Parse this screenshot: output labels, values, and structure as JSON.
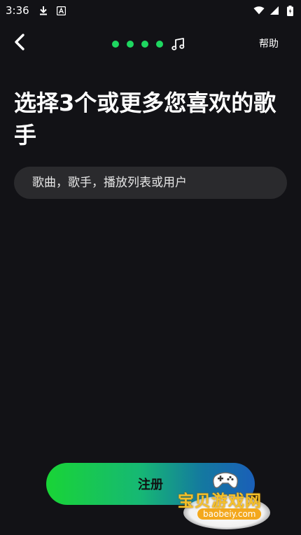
{
  "status_bar": {
    "time": "3:36"
  },
  "nav": {
    "help_label": "帮助",
    "progress_dots": 4,
    "accent_color": "#1ed760"
  },
  "page": {
    "title": "选择3个或更多您喜欢的歌手"
  },
  "search": {
    "placeholder": "歌曲，歌手，播放列表或用户"
  },
  "actions": {
    "register_label": "注册"
  },
  "watermark": {
    "text": "宝贝游戏网",
    "url": "baobeiy.com"
  },
  "icons": {
    "back": "chevron-left-icon",
    "music": "music-note-icon",
    "download": "download-icon",
    "keyboard": "font-a-icon",
    "wifi": "wifi-icon",
    "signal": "signal-icon",
    "battery": "battery-icon"
  }
}
